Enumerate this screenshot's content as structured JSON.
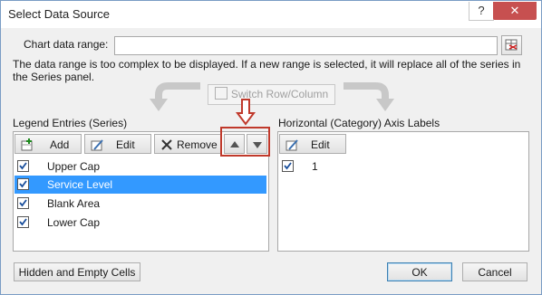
{
  "window": {
    "title": "Select Data Source",
    "help_label": "?",
    "close_label": "✕"
  },
  "range": {
    "label": "Chart data range:",
    "value": "",
    "description": "The data range is too complex to be displayed. If a new range is selected, it will replace all of the series in the Series panel."
  },
  "switch_button": {
    "label": "Switch Row/Column",
    "enabled": false
  },
  "legend": {
    "heading": "Legend Entries (Series)",
    "add_label": "Add",
    "edit_label": "Edit",
    "remove_label": "Remove",
    "move_up_icon": "triangle-up-icon",
    "move_down_icon": "triangle-down-icon",
    "series": [
      {
        "label": "Upper Cap",
        "checked": true,
        "selected": false
      },
      {
        "label": "Service Level",
        "checked": true,
        "selected": true
      },
      {
        "label": "Blank Area",
        "checked": true,
        "selected": false
      },
      {
        "label": "Lower Cap",
        "checked": true,
        "selected": false
      }
    ]
  },
  "axis": {
    "heading": "Horizontal (Category) Axis Labels",
    "edit_label": "Edit",
    "items": [
      {
        "label": "1",
        "checked": true
      }
    ]
  },
  "footer": {
    "hidden_cells_label": "Hidden and Empty Cells",
    "ok_label": "OK",
    "cancel_label": "Cancel"
  },
  "colors": {
    "selection": "#3399ff",
    "annotation": "#c0392b",
    "close": "#c75050"
  }
}
